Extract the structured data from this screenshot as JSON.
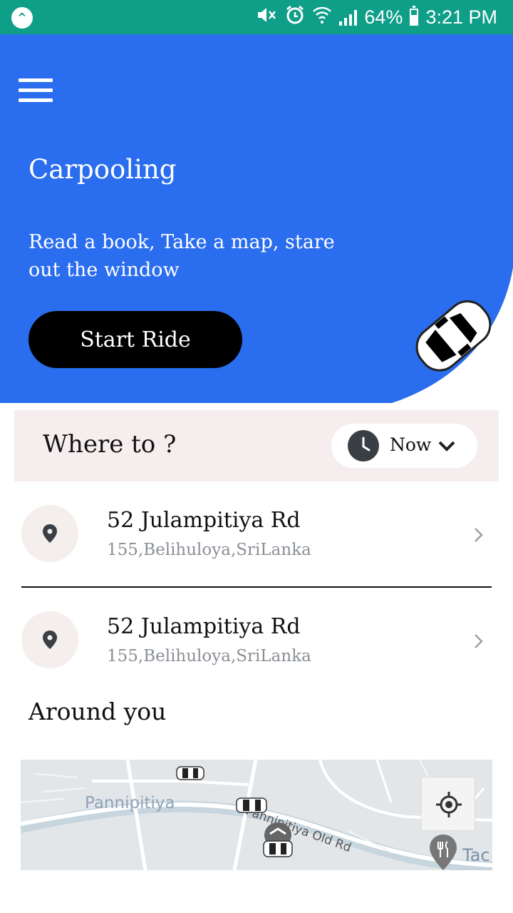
{
  "status_bar": {
    "battery": "64%",
    "time": "3:21 PM",
    "icons": [
      "mute-icon",
      "alarm-icon",
      "wifi-icon",
      "signal-icon",
      "battery-icon"
    ]
  },
  "hero": {
    "title": "Carpooling",
    "subtitle": "Read a book, Take a map, stare out the window",
    "button_label": "Start Ride",
    "background": "#2a6dee"
  },
  "where_to": {
    "label": "Where to ?",
    "time_option": "Now"
  },
  "locations": [
    {
      "title": "52 Julampitiya Rd",
      "address": "155,Belihuloya,SriLanka"
    },
    {
      "title": "52 Julampitiya Rd",
      "address": "155,Belihuloya,SriLanka"
    }
  ],
  "around": {
    "heading": "Around you",
    "map_labels": [
      "Pannipitiya",
      "Pannipitiya Old Rd",
      "Tac"
    ]
  }
}
